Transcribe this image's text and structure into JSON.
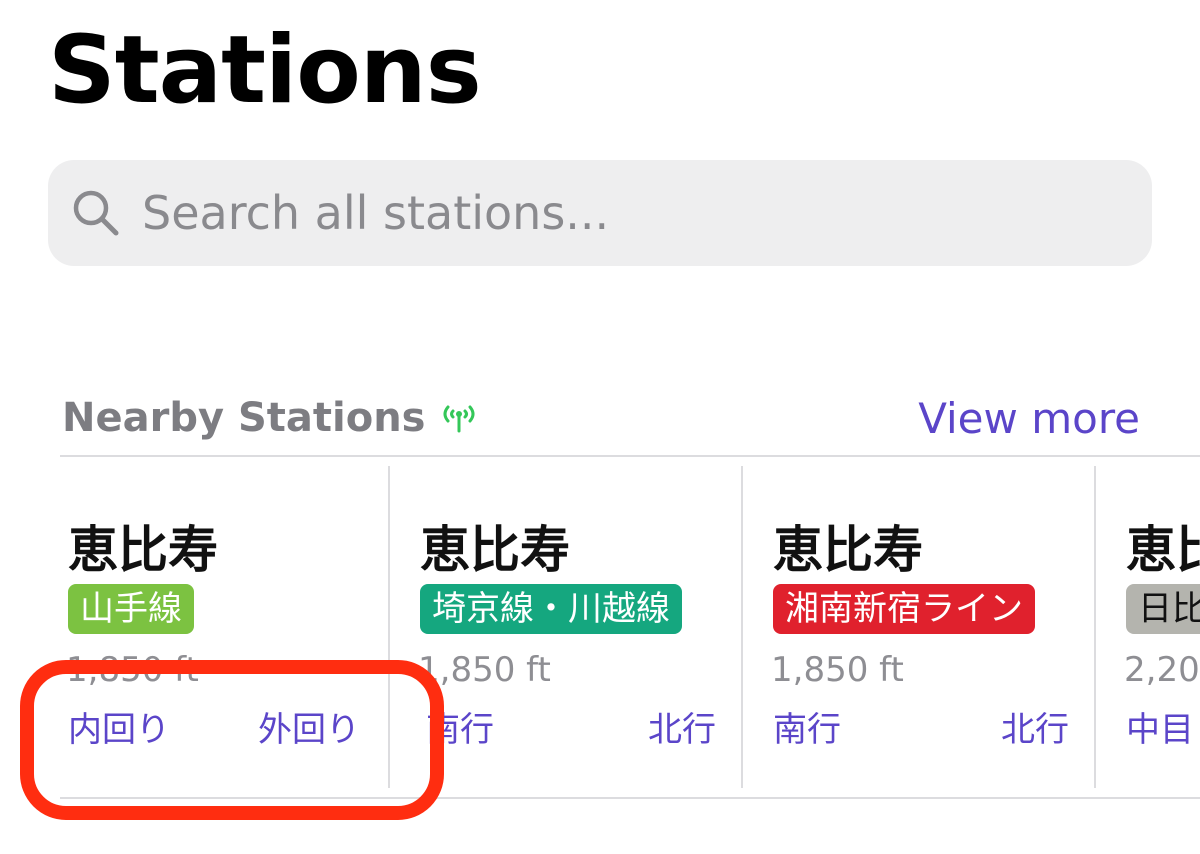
{
  "header": {
    "title": "Stations"
  },
  "search": {
    "placeholder": "Search all stations..."
  },
  "nearby": {
    "title": "Nearby Stations",
    "view_more": "View more",
    "stations": [
      {
        "name": "恵比寿",
        "line": "山手線",
        "line_color": "#7cc241",
        "distance": "1,850 ft",
        "dir_left": "内回り",
        "dir_right": "外回り"
      },
      {
        "name": "恵比寿",
        "line": "埼京線・川越線",
        "line_color": "#15a77f",
        "distance": "1,850 ft",
        "dir_left": "南行",
        "dir_right": "北行"
      },
      {
        "name": "恵比寿",
        "line": "湘南新宿ライン",
        "line_color": "#e0212d",
        "distance": "1,850 ft",
        "dir_left": "南行",
        "dir_right": "北行"
      },
      {
        "name": "恵比",
        "line": "日比",
        "line_color": "#b4b4ae",
        "distance": "2,20",
        "dir_left": "中目"
      }
    ]
  },
  "colors": {
    "accent": "#5b45c9",
    "annotation": "#ff2d10",
    "signal_icon": "#34c759"
  },
  "icons": {
    "search": "search-icon",
    "signal": "antenna-signal-icon"
  }
}
